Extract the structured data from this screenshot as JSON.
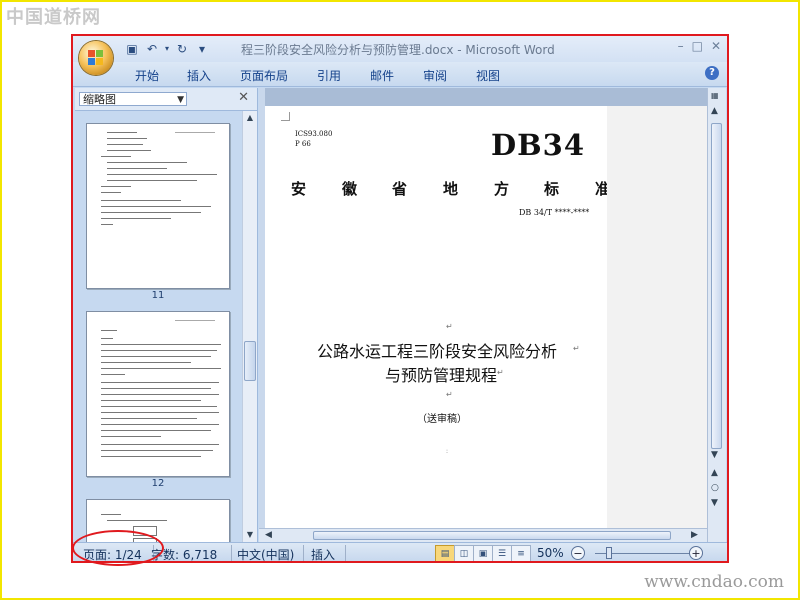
{
  "watermark": {
    "top": "中国道桥网",
    "bottom": "www.cndao.com"
  },
  "titlebar": {
    "title": "程三阶段安全风险分析与预防管理.docx - Microsoft Word",
    "qat_more": "▾"
  },
  "ribbon": {
    "tabs": [
      "开始",
      "插入",
      "页面布局",
      "引用",
      "邮件",
      "审阅",
      "视图"
    ]
  },
  "thumbnails": {
    "view_label": "缩略图",
    "pages": [
      "11",
      "12"
    ]
  },
  "document": {
    "ics": "ICS93.080",
    "p_code": "P 66",
    "std_code": "DB34",
    "issuer_chars": [
      "安",
      "徽",
      "省",
      "地",
      "方",
      "标",
      "准"
    ],
    "std_number": "DB 34/T ****-****",
    "title_line1": "公路水运工程三阶段安全风险分析",
    "title_line2": "与预防管理规程",
    "draft_note": "（送审稿）"
  },
  "status": {
    "page": "页面: 1/24",
    "words": "字数: 6,718",
    "language": "中文(中国)",
    "mode": "插入",
    "zoom": "50%",
    "zoom_level_percent": 50
  },
  "colors": {
    "annotation": "#e0191e",
    "frame": "#f2e600",
    "ribbon_text": "#15428b"
  }
}
